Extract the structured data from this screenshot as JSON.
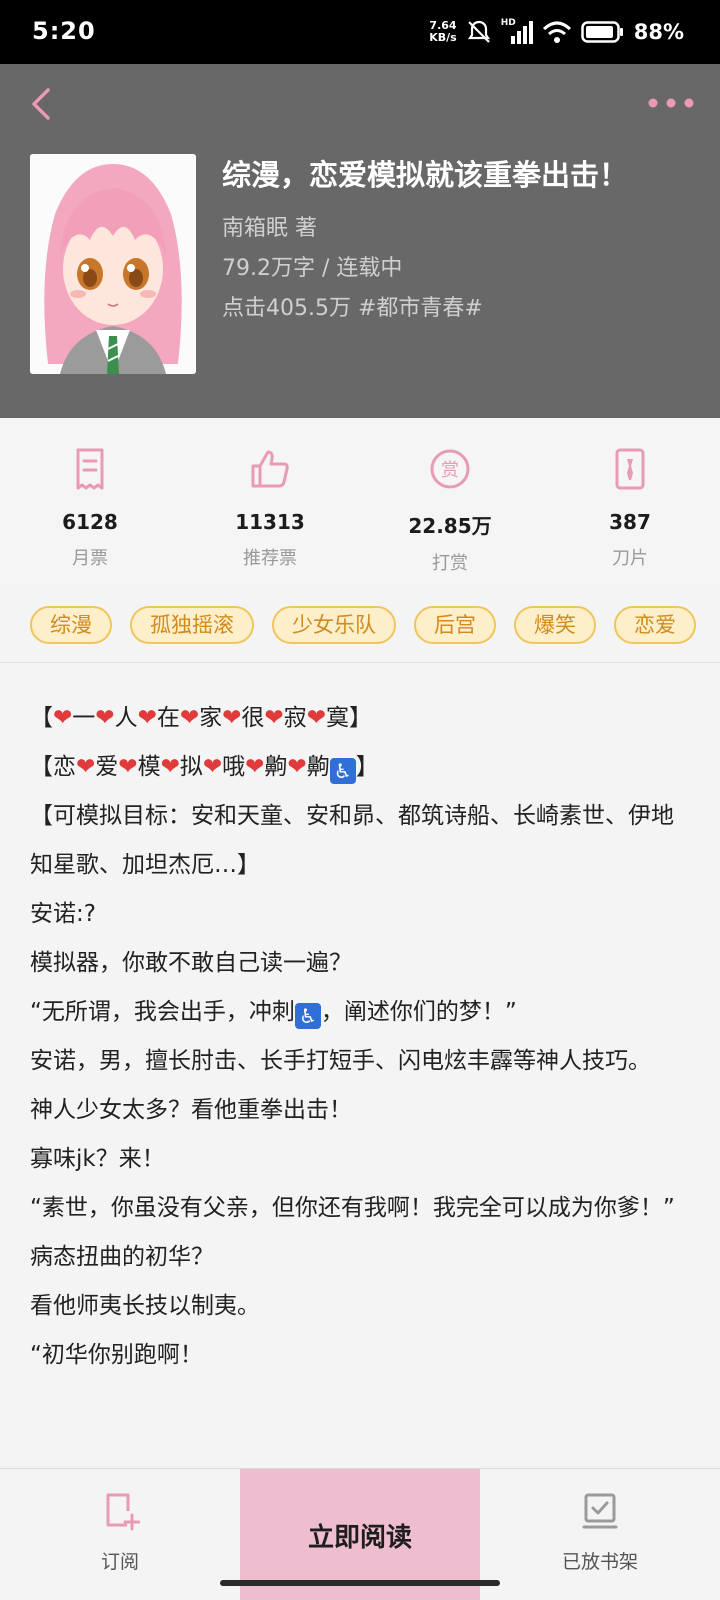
{
  "status_bar": {
    "time": "5:20",
    "speed_value": "7.64",
    "speed_unit": "KB/s",
    "hd_label": "HD",
    "battery_percent": "88%"
  },
  "header": {
    "book_title": "综漫，恋爱模拟就该重拳出击！",
    "author_line": "南箱眠  著",
    "word_status": "79.2万字 / 连载中",
    "clicks_genre": "点击405.5万  #都市青春#"
  },
  "stats": [
    {
      "value": "6128",
      "label": "月票",
      "icon": "monthly-ticket-icon"
    },
    {
      "value": "11313",
      "label": "推荐票",
      "icon": "thumbs-up-icon"
    },
    {
      "value": "22.85万",
      "label": "打赏",
      "icon": "reward-icon"
    },
    {
      "value": "387",
      "label": "刀片",
      "icon": "blade-ticket-icon"
    }
  ],
  "tags": [
    "综漫",
    "孤独摇滚",
    "少女乐队",
    "后宫",
    "爆笑",
    "恋爱"
  ],
  "intro": {
    "line1": [
      "【",
      "一",
      "人",
      "在",
      "家",
      "很",
      "寂",
      "寞】"
    ],
    "line2": [
      "【恋",
      "爱",
      "模",
      "拟",
      "哦",
      "齁",
      "齁",
      "】"
    ],
    "line3": "【可模拟目标：安和天童、安和昴、都筑诗船、长崎素世、伊地知星歌、加坦杰厄…】",
    "line4": "安诺:?",
    "line5": "模拟器，你敢不敢自己读一遍？",
    "line6_pre": "“无所谓，我会出手，冲刺",
    "line6_post": "，阐述你们的梦！”",
    "line7": "安诺，男，擅长肘击、长手打短手、闪电炫丰霹等神人技巧。",
    "line8": "神人少女太多？看他重拳出击！",
    "line9": "寡味jk？来！",
    "line10": "“素世，你虽没有父亲，但你还有我啊！我完全可以成为你爹！”",
    "line11": "病态扭曲的初华？",
    "line12": "看他师夷长技以制夷。",
    "line13": "“初华你别跑啊！"
  },
  "bottom_bar": {
    "subscribe_label": "订阅",
    "read_label": "立即阅读",
    "shelf_label": "已放书架"
  },
  "colors": {
    "accent_pink": "#e89ab6",
    "read_button_bg": "#efbdd0",
    "tag_border": "#efc55e",
    "tag_text": "#d28a1c",
    "header_bg": "#686868"
  }
}
